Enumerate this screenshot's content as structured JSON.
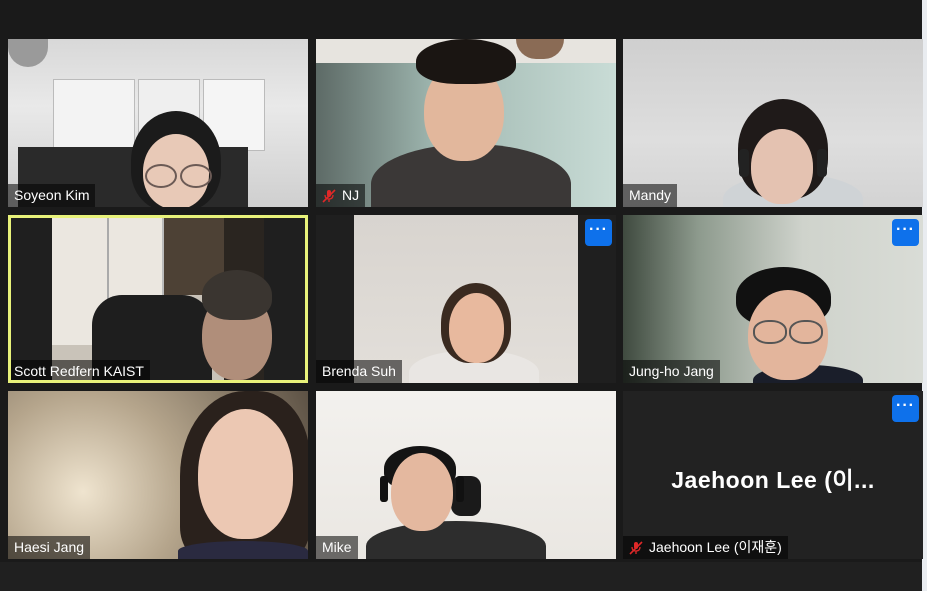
{
  "participants": [
    {
      "name": "Soyeon Kim",
      "muted": false,
      "active_speaker": false
    },
    {
      "name": "NJ",
      "muted": true,
      "active_speaker": false
    },
    {
      "name": "Mandy",
      "muted": false,
      "active_speaker": false
    },
    {
      "name": "Scott Redfern KAIST",
      "muted": false,
      "active_speaker": true
    },
    {
      "name": "Brenda Suh",
      "muted": false,
      "active_speaker": false
    },
    {
      "name": "Jung-ho Jang",
      "muted": false,
      "active_speaker": false
    },
    {
      "name": "Haesi Jang",
      "muted": false,
      "active_speaker": false
    },
    {
      "name": "Mike",
      "muted": false,
      "active_speaker": false
    },
    {
      "name": "Jaehoon Lee (이재훈)",
      "muted": true,
      "active_speaker": false,
      "video_off": true,
      "display_name": "Jaehoon Lee (이..."
    }
  ],
  "more_button": {
    "label": "···",
    "icon": "more-options-icon"
  },
  "colors": {
    "active_border": "#e8f27a",
    "more_button": "#0e71eb",
    "mute_icon": "#e02828",
    "background": "#1a1a1a"
  }
}
